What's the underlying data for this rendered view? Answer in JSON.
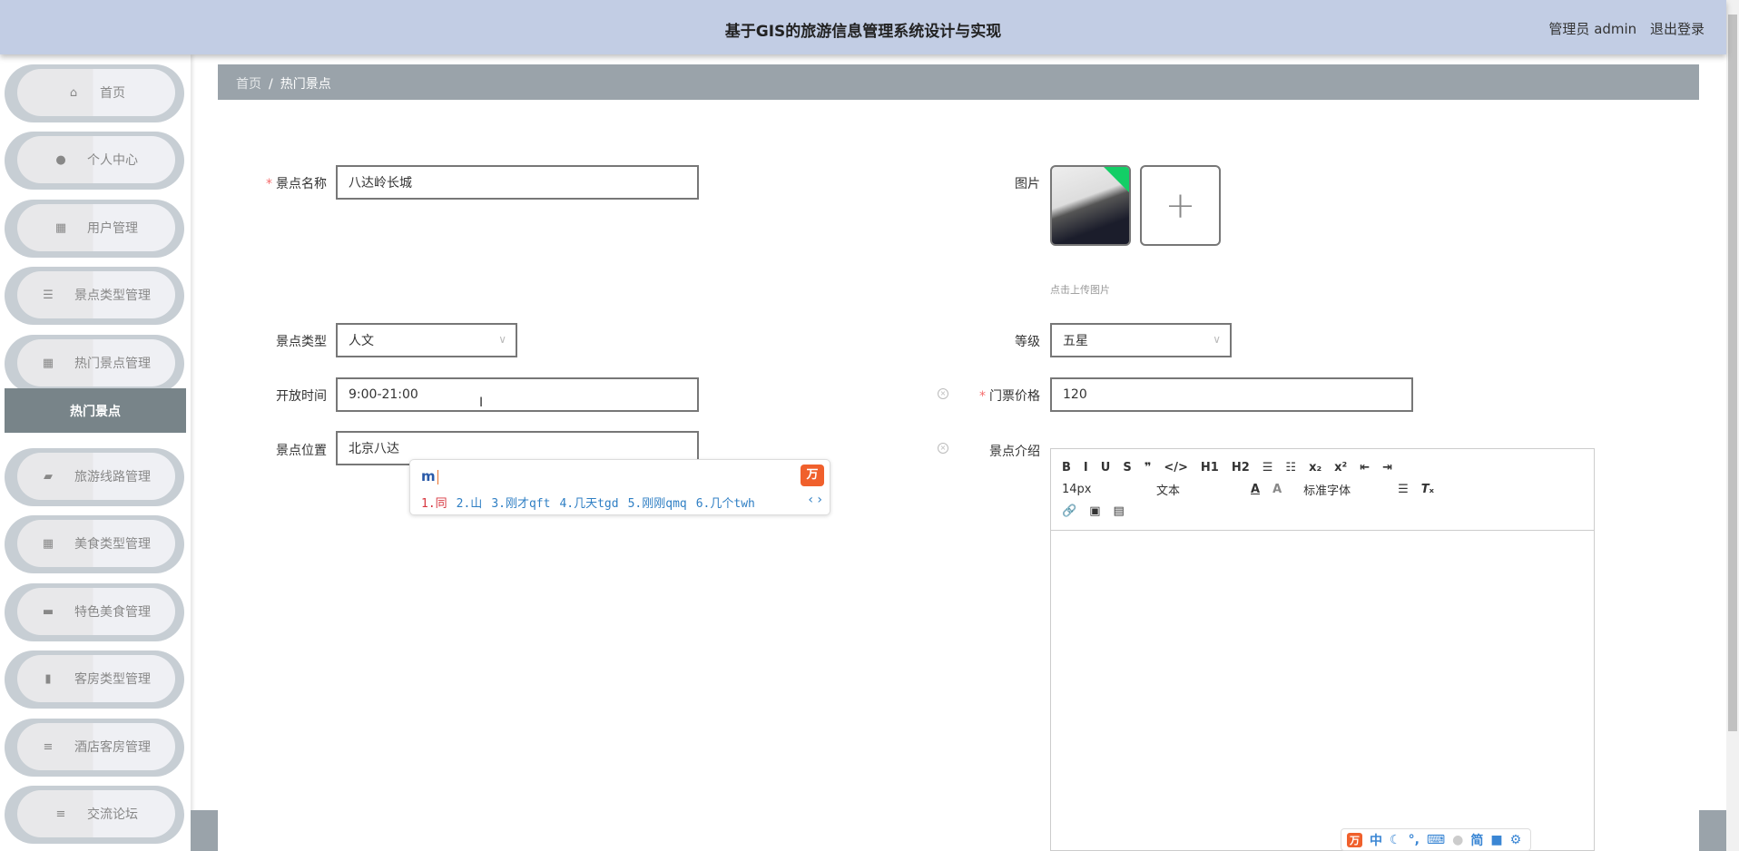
{
  "header": {
    "title": "基于GIS的旅游信息管理系统设计与实现",
    "user": "管理员 admin",
    "logout": "退出登录"
  },
  "sidebar": {
    "items": [
      {
        "label": "首页",
        "icon": "home-icon"
      },
      {
        "label": "个人中心",
        "icon": "user-icon"
      },
      {
        "label": "用户管理",
        "icon": "grid-icon"
      },
      {
        "label": "景点类型管理",
        "icon": "sliders-icon"
      },
      {
        "label": "热门景点管理",
        "icon": "grid-icon"
      },
      {
        "label": "旅游线路管理",
        "icon": "wallet-icon"
      },
      {
        "label": "美食类型管理",
        "icon": "grid-icon"
      },
      {
        "label": "特色美食管理",
        "icon": "briefcase-icon"
      },
      {
        "label": "客房类型管理",
        "icon": "bar-chart-icon"
      },
      {
        "label": "酒店客房管理",
        "icon": "list-icon"
      },
      {
        "label": "交流论坛",
        "icon": "list-icon"
      }
    ],
    "submenu": "热门景点"
  },
  "breadcrumb": {
    "home": "首页",
    "sep": "/",
    "current": "热门景点"
  },
  "form": {
    "name_label": "景点名称",
    "name_value": "八达岭长城",
    "image_label": "图片",
    "image_hint": "点击上传图片",
    "add": "+",
    "type_label": "景点类型",
    "type_value": "人文",
    "level_label": "等级",
    "level_value": "五星",
    "time_label": "开放时间",
    "time_value": "9:00-21:00",
    "price_label": "门票价格",
    "price_value": "120",
    "location_label": "景点位置",
    "location_value": "北京八达",
    "intro_label": "景点介绍",
    "required": "*"
  },
  "editor": {
    "row1": [
      "B",
      "I",
      "U",
      "S",
      "❞",
      "</>",
      "H1",
      "H2",
      "☰",
      "☷",
      "x₂",
      "x²",
      "⇤",
      "⇥"
    ],
    "font_size": "14px",
    "text_style": "文本",
    "font_family": "标准字体"
  },
  "ime": {
    "code": "m",
    "candidates": [
      "1.同",
      "2.山",
      "3.刚才qft",
      "4.几天tgd",
      "5.刚刚qmq",
      "6.几个twh"
    ],
    "logo": "万",
    "bar": [
      "中",
      "☾",
      "°,",
      "⌨",
      "简"
    ]
  }
}
